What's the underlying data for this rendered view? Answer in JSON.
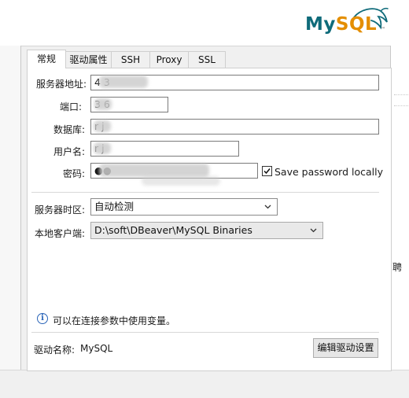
{
  "header": {
    "logo": {
      "my": "My",
      "sql": "SQL",
      "tm": "™"
    }
  },
  "tabs": [
    {
      "label": "常规",
      "active": true
    },
    {
      "label": "驱动属性"
    },
    {
      "label": "SSH"
    },
    {
      "label": "Proxy"
    },
    {
      "label": "SSL"
    }
  ],
  "form": {
    "host_label": "服务器地址:",
    "host_value": "4             3",
    "port_label": "端口:",
    "port_value": "3   6",
    "database_label": "数据库:",
    "database_value": "r   j",
    "user_label": "用户名:",
    "user_value": "r   j",
    "password_label": "密码:",
    "password_value": "●●",
    "save_password_label": "Save password locally",
    "save_password_checked": true,
    "timezone_label": "服务器时区:",
    "timezone_value": "自动检测",
    "client_label": "本地客户端:",
    "client_value": "D:\\soft\\DBeaver\\MySQL Binaries"
  },
  "info": {
    "text": "可以在连接参数中使用变量。"
  },
  "driver": {
    "label": "驱动名称:",
    "value": "MySQL",
    "edit_button": "编辑驱动设置"
  },
  "side": {
    "right_glyph": "聘"
  },
  "colors": {
    "mysql_blue": "#0f6b7a",
    "mysql_orange": "#e48e00",
    "info_blue": "#2a64b8"
  }
}
